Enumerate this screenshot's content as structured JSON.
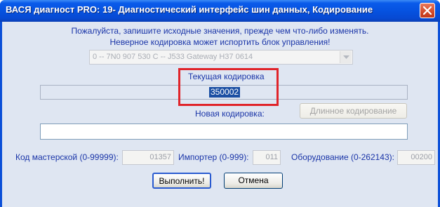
{
  "window": {
    "title": "ВАСЯ диагност PRO: 19- Диагностический интерфейс шин данных,  Кодирование"
  },
  "messages": {
    "line1": "Пожалуйста, запишите исходные значения, прежде чем что-либо изменять.",
    "line2": "Неверное кодировка может испортить блок управления!"
  },
  "module_select": {
    "selected": "0 -- 7N0 907 530 C -- J533  Gateway H37 0614"
  },
  "current_coding": {
    "label": "Текущая кодировка",
    "value": "350002"
  },
  "new_coding": {
    "label": "Новая кодировка:",
    "value": ""
  },
  "long_coding_button": "Длинное кодирование",
  "fields": {
    "workshop_label": "Код мастерской (0-99999):",
    "workshop_value": "01357",
    "importer_label": "Импортер (0-999):",
    "importer_value": "011",
    "equipment_label": "Оборудование (0-262143):",
    "equipment_value": "00200"
  },
  "buttons": {
    "execute": "Выполнить!",
    "cancel": "Отмена"
  },
  "colors": {
    "title_bar": "#0652e0",
    "client_bg": "#dfe6f2",
    "label_text": "#1a35a8",
    "highlight": "#e0242a",
    "selection": "#1b4fa3"
  },
  "icons": {
    "close": "close-icon",
    "dropdown": "chevron-down-icon"
  }
}
